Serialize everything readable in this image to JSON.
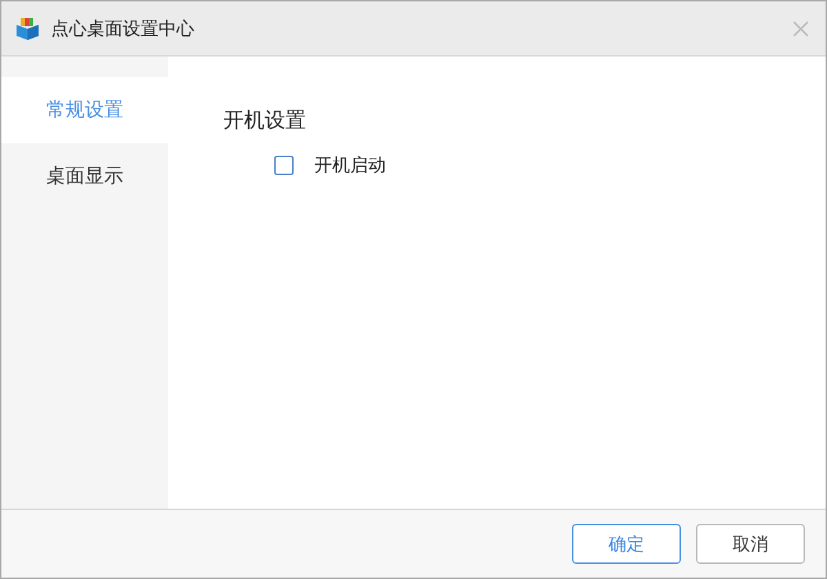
{
  "window": {
    "title": "点心桌面设置中心"
  },
  "sidebar": {
    "items": [
      {
        "label": "常规设置",
        "selected": true
      },
      {
        "label": "桌面显示",
        "selected": false
      }
    ]
  },
  "section": {
    "heading": "开机设置",
    "options": [
      {
        "label": "开机启动",
        "checked": false
      }
    ]
  },
  "buttons": [
    {
      "label": "确定",
      "kind": "primary"
    },
    {
      "label": "取消",
      "kind": "secondary"
    }
  ]
}
